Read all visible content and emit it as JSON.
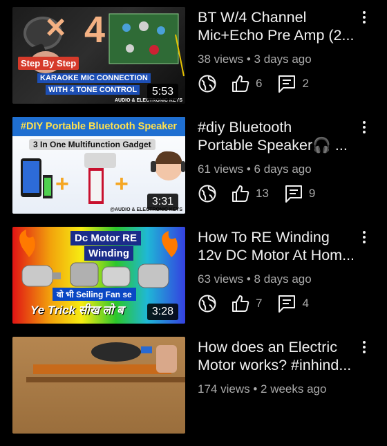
{
  "videos": [
    {
      "title_line1": "BT W/4 Channel",
      "title_line2": "Mic+Echo Pre Amp (2...",
      "views": "38 views",
      "age": "3 days ago",
      "likes": "6",
      "comments": "2",
      "duration": "5:53",
      "thumb_text": {
        "step": "Step By Step",
        "line1": "KARAOKE MIC CONNECTION",
        "line2": "WITH 4 TONE CONTROL",
        "brand": "AUDIO & ELECTRONIC KEYS"
      }
    },
    {
      "title_line1": "#diy Bluetooth",
      "title_line2": "Portable Speaker🎧 ...",
      "views": "61 views",
      "age": "6 days ago",
      "likes": "13",
      "comments": "9",
      "duration": "3:31",
      "thumb_text": {
        "header": "#DIY Portable Bluetooth Speaker",
        "sub": "3 In One Multifunction Gadget",
        "brand": "@AUDIO & ELECTRONIC KEYS"
      }
    },
    {
      "title_line1": "How To RE Winding",
      "title_line2": "12v DC Motor At Hom...",
      "views": "63 views",
      "age": "8 days ago",
      "likes": "7",
      "comments": "4",
      "duration": "3:28",
      "thumb_text": {
        "header1": "Dc Motor RE",
        "header2": "Winding",
        "fan": "वो भी Seiling Fan se",
        "trick": "Ye Trick सीख लो ब"
      }
    },
    {
      "title_line1": "How does an Electric",
      "title_line2": "Motor works? #inhind...",
      "views": "174 views",
      "age": "2 weeks ago"
    }
  ],
  "separator": " • ",
  "colors": {
    "background": "#000000",
    "title": "#f1f1f1",
    "meta": "#aaaaaa"
  }
}
